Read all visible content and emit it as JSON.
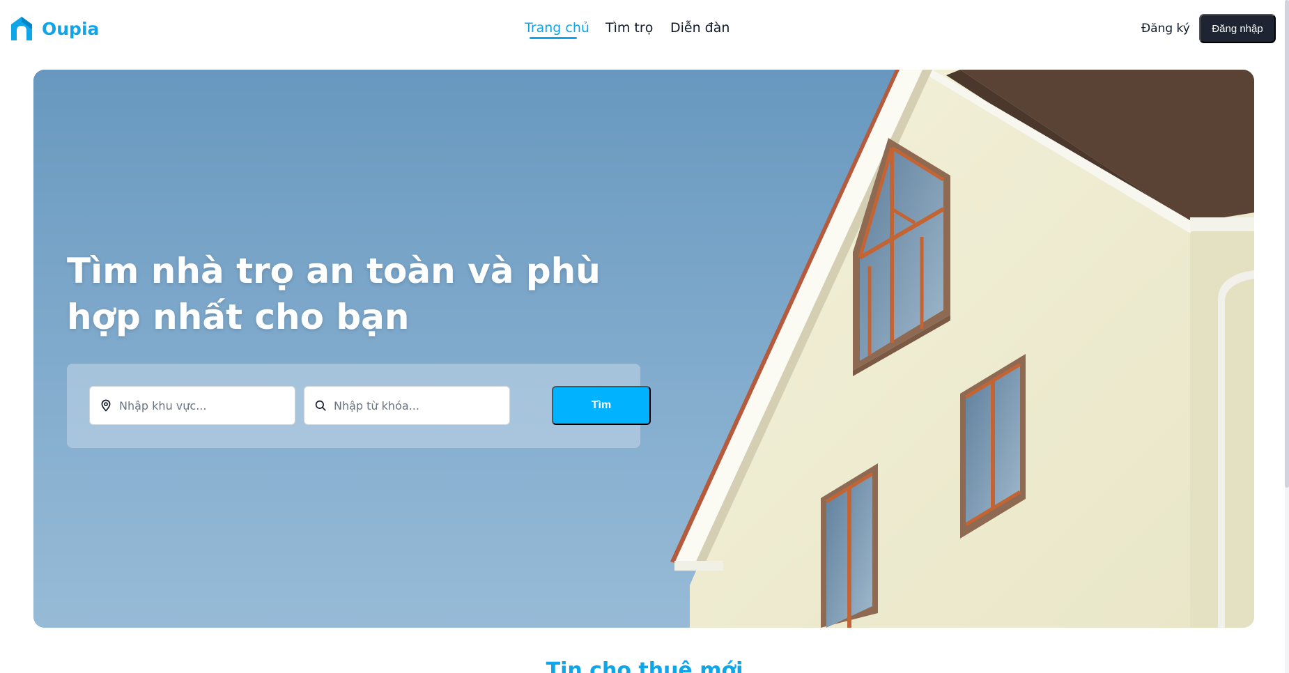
{
  "brand": {
    "name": "Oupia",
    "logo_icon": "house-logo-icon",
    "color": "#0ea5e9"
  },
  "nav": {
    "items": [
      {
        "label": "Trang chủ",
        "active": true
      },
      {
        "label": "Tìm trọ",
        "active": false
      },
      {
        "label": "Diễn đàn",
        "active": false
      }
    ]
  },
  "auth": {
    "signup_label": "Đăng ký",
    "login_label": "Đăng nhập"
  },
  "hero": {
    "title": "Tìm nhà trọ an toàn và phù hợp nhất cho bạn",
    "image": "house-under-blue-sky-photo",
    "search": {
      "area_placeholder": "Nhập khu vực...",
      "area_icon": "map-pin-icon",
      "keyword_placeholder": "Nhập từ khóa...",
      "keyword_icon": "search-icon",
      "button_label": "Tìm"
    }
  },
  "section": {
    "title": "Tin cho thuê mới"
  },
  "colors": {
    "accent": "#0ea5e9",
    "search_button": "#00b2ff",
    "login_button": "#1e2432"
  }
}
